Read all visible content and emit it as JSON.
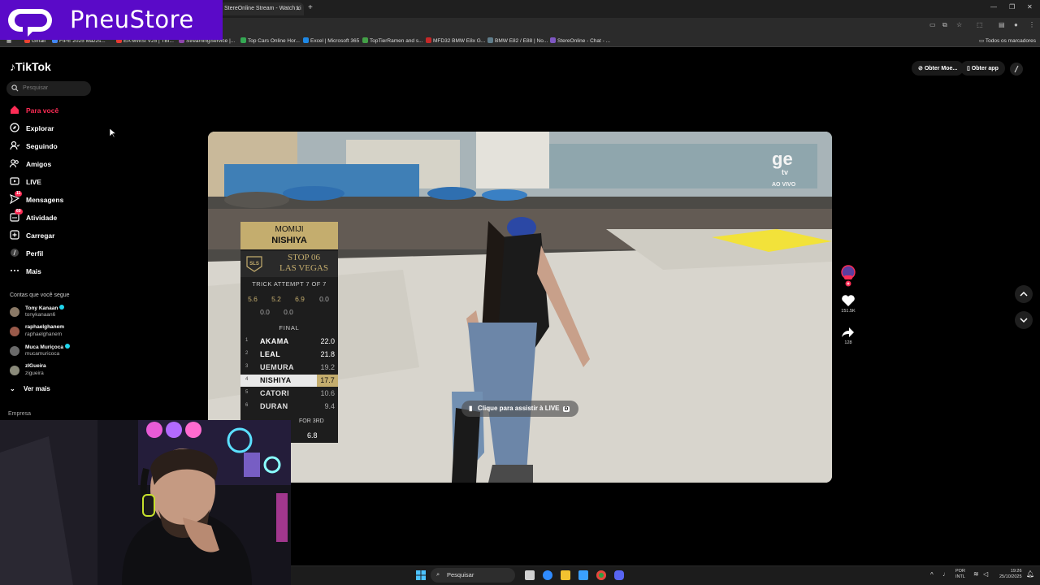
{
  "browser": {
    "active_tab_title": "StereOnline Stream - Watch Li",
    "bookmarks": [
      {
        "label": "Gmail",
        "color": "#ea4335"
      },
      {
        "label": "FIPE 2025 Mazzs...",
        "color": "#4285f4"
      },
      {
        "label": "EA MWSI V25 | TBI...",
        "color": "#e53935"
      },
      {
        "label": "StreamingService |...",
        "color": "#8e44ad"
      },
      {
        "label": "Top Cars Online Hor...",
        "color": "#34a853"
      },
      {
        "label": "Excel | Microsoft 365",
        "color": "#1e88e5"
      },
      {
        "label": "TopTierRamen and s...",
        "color": "#43a047"
      },
      {
        "label": "MFD32 BMW E8x G...",
        "color": "#c62828"
      },
      {
        "label": "BMW E82 / E88 | No...",
        "color": "#607d8b"
      },
      {
        "label": "StereOnline - Chat - ...",
        "color": "#7e57c2"
      }
    ],
    "all_bookmarks_label": "Todos os marcadores"
  },
  "overlay_logo": {
    "text": "PneuStore",
    "color": "#5a0ac8"
  },
  "tiktok": {
    "brand": "TikTok",
    "search_placeholder": "Pesquisar",
    "nav": [
      {
        "label": "Para você",
        "icon": "home-icon",
        "active": true
      },
      {
        "label": "Explorar",
        "icon": "compass-icon"
      },
      {
        "label": "Seguindo",
        "icon": "following-icon"
      },
      {
        "label": "Amigos",
        "icon": "friends-icon"
      },
      {
        "label": "LIVE",
        "icon": "live-icon"
      },
      {
        "label": "Mensagens",
        "icon": "messages-icon",
        "badge": "11"
      },
      {
        "label": "Atividade",
        "icon": "activity-icon",
        "badge": "60"
      },
      {
        "label": "Carregar",
        "icon": "upload-icon"
      },
      {
        "label": "Perfil",
        "icon": "profile-icon"
      },
      {
        "label": "Mais",
        "icon": "more-icon"
      }
    ],
    "following_title": "Contas que você segue",
    "accounts": [
      {
        "name": "Tony Kanaan",
        "user": "tonykanaan6",
        "verified": true
      },
      {
        "name": "raphaelghanem",
        "user": "raphaelghanem",
        "verified": false
      },
      {
        "name": "Muca Muriçoca",
        "user": "mucamuricoca",
        "verified": true
      },
      {
        "name": "zIGueira",
        "user": "zigueira",
        "verified": false
      }
    ],
    "see_more": "Ver mais",
    "company": "Empresa",
    "top_buttons": {
      "get_coins": "Obter Moe...",
      "get_app": "Obter app"
    },
    "actions": {
      "likes": "151.5K",
      "shares": "128"
    },
    "live_button": {
      "label": "Clique para assistir à LIVE",
      "key": "D"
    }
  },
  "broadcast": {
    "ge_logo": "ge",
    "ge_tv": "tv",
    "ge_live": "AO VIVO",
    "skater_first": "MOMIJI",
    "skater_last": "NISHIYA",
    "event_line1": "STOP 06",
    "event_line2": "LAS VEGAS",
    "sls": "SLS",
    "attempt": "TRICK ATTEMPT 7 OF 7",
    "scores": [
      "5.6",
      "5.2",
      "6.9",
      "0.0",
      "0.0",
      "0.0"
    ],
    "final_label": "FINAL",
    "leaderboard": [
      {
        "pos": "1",
        "name": "AKAMA",
        "score": "22.0"
      },
      {
        "pos": "2",
        "name": "LEAL",
        "score": "21.8"
      },
      {
        "pos": "3",
        "name": "UEMURA",
        "score": "19.2"
      },
      {
        "pos": "4",
        "name": "NISHIYA",
        "score": "17.7"
      },
      {
        "pos": "5",
        "name": "CATORI",
        "score": "10.6"
      },
      {
        "pos": "6",
        "name": "DURAN",
        "score": "9.4"
      }
    ],
    "for_place": "FOR 3RD",
    "needed": "6.8"
  },
  "taskbar": {
    "search": "Pesquisar",
    "lang_line1": "POR",
    "lang_line2": "INTL",
    "time": "19:26",
    "date": "25/10/2025"
  }
}
